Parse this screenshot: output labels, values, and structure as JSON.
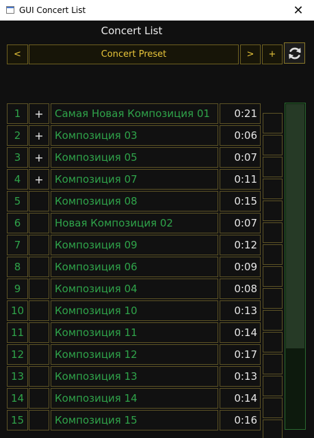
{
  "window": {
    "title": "GUI Concert List",
    "close_glyph": "✕"
  },
  "heading": "Concert List",
  "toolbar": {
    "prev_label": "<",
    "preset_label": "Concert Preset",
    "next_label": ">",
    "add_label": "+",
    "refresh_icon": "refresh-icon"
  },
  "songs": [
    {
      "num": "1",
      "add": "+",
      "name": "Самая Новая Композиция 01",
      "time": "0:21"
    },
    {
      "num": "2",
      "add": "+",
      "name": "Композиция 03",
      "time": "0:06"
    },
    {
      "num": "3",
      "add": "+",
      "name": "Композиция 05",
      "time": "0:07"
    },
    {
      "num": "4",
      "add": "+",
      "name": "Композиция 07",
      "time": "0:11"
    },
    {
      "num": "5",
      "add": "",
      "name": "Композиция 08",
      "time": "0:15"
    },
    {
      "num": "6",
      "add": "",
      "name": "Новая Композиция 02",
      "time": "0:07"
    },
    {
      "num": "7",
      "add": "",
      "name": "Композиция 09",
      "time": "0:12"
    },
    {
      "num": "8",
      "add": "",
      "name": "Композиция 06",
      "time": "0:09"
    },
    {
      "num": "9",
      "add": "",
      "name": "Композиция 04",
      "time": "0:08"
    },
    {
      "num": "10",
      "add": "",
      "name": "Композиция 10",
      "time": "0:13"
    },
    {
      "num": "11",
      "add": "",
      "name": "Композиция 11",
      "time": "0:14"
    },
    {
      "num": "12",
      "add": "",
      "name": "Композиция 12",
      "time": "0:17"
    },
    {
      "num": "13",
      "add": "",
      "name": "Композиция 13",
      "time": "0:13"
    },
    {
      "num": "14",
      "add": "",
      "name": "Композиция 14",
      "time": "0:14"
    },
    {
      "num": "15",
      "add": "",
      "name": "Композиция 15",
      "time": "0:16"
    }
  ],
  "scrollbar": {
    "visible_fraction": 0.75,
    "position_fraction": 0.0
  },
  "colors": {
    "background": "#101010",
    "accent_yellow": "#e8c53a",
    "song_green": "#2fa44a",
    "border": "#5e5426",
    "scroll_green": "#2a6a30"
  }
}
